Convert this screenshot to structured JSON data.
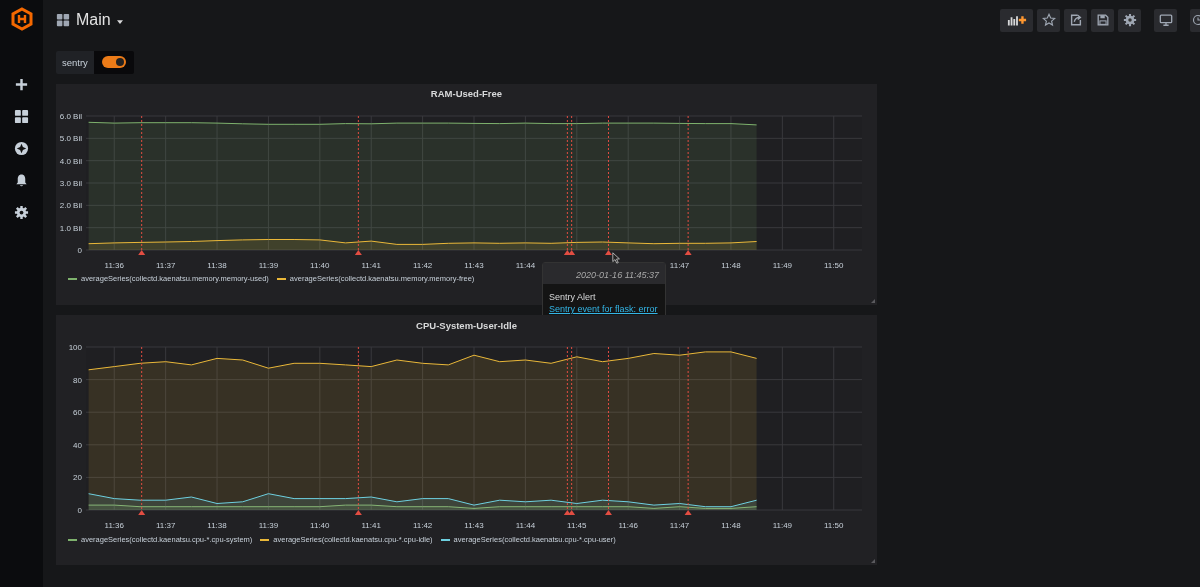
{
  "dashboard": {
    "title": "Main"
  },
  "variables": [
    {
      "label": "sentry",
      "on": true
    }
  ],
  "panels": [
    {
      "title": "RAM-Used-Free",
      "chart_data": {
        "type": "area",
        "categories": [
          null,
          "11:36",
          null,
          "11:37",
          null,
          "11:38",
          null,
          "11:39",
          null,
          "11:40",
          null,
          "11:41",
          null,
          "11:42",
          null,
          "11:43",
          null,
          "11:44",
          null,
          null,
          null,
          null,
          null,
          "11:47",
          null,
          "11:48",
          null,
          "11:49",
          null,
          "11:50",
          null
        ],
        "ylim": [
          0,
          6
        ],
        "yticks": [
          {
            "value": 0,
            "label": "0"
          },
          {
            "value": 1,
            "label": "1.0 Bil"
          },
          {
            "value": 2,
            "label": "2.0 Bil"
          },
          {
            "value": 3,
            "label": "3.0 Bil"
          },
          {
            "value": 4,
            "label": "4.0 Bil"
          },
          {
            "value": 5,
            "label": "5.0 Bil"
          },
          {
            "value": 6,
            "label": "6.0 Bil"
          }
        ],
        "series": [
          {
            "name": "averageSeries(collectd.kaenatsu.memory.memory-used)",
            "color": "#7eb26d",
            "values": [
              5.72,
              5.68,
              5.7,
              5.7,
              5.7,
              5.68,
              5.65,
              5.63,
              5.63,
              5.63,
              5.66,
              5.65,
              5.68,
              5.68,
              5.68,
              5.67,
              5.66,
              5.68,
              5.66,
              5.66,
              5.68,
              5.68,
              5.68,
              5.67,
              5.66,
              5.66,
              5.6,
              null,
              null,
              null,
              null
            ]
          },
          {
            "name": "averageSeries(collectd.kaenatsu.memory.memory-free)",
            "color": "#eab839",
            "values": [
              0.28,
              0.32,
              0.34,
              0.36,
              0.38,
              0.42,
              0.45,
              0.47,
              0.47,
              0.45,
              0.32,
              0.4,
              0.25,
              0.25,
              0.3,
              0.32,
              0.3,
              0.32,
              0.3,
              0.34,
              0.36,
              0.32,
              0.28,
              0.3,
              0.3,
              0.32,
              0.38,
              null,
              null,
              null,
              null
            ]
          }
        ],
        "grid": true,
        "annotations": [
          {
            "x": "11:36:32"
          },
          {
            "x": "11:40:45"
          },
          {
            "x": "11:44:49"
          },
          {
            "x": "11:44:54"
          },
          {
            "x": "11:45:37"
          },
          {
            "x": "11:47:10"
          }
        ]
      },
      "tooltip": {
        "time": "2020-01-16 11:45:37",
        "title": "Sentry Alert",
        "link": "Sentry event for flask: error"
      }
    },
    {
      "title": "CPU-System-User-Idle",
      "chart_data": {
        "type": "area",
        "categories": [
          null,
          "11:36",
          null,
          "11:37",
          null,
          "11:38",
          null,
          "11:39",
          null,
          "11:40",
          null,
          "11:41",
          null,
          "11:42",
          null,
          "11:43",
          null,
          "11:44",
          null,
          "11:45",
          null,
          "11:46",
          null,
          "11:47",
          null,
          "11:48",
          null,
          "11:49",
          null,
          "11:50",
          null
        ],
        "ylim": [
          0,
          100
        ],
        "yticks": [
          0,
          20,
          40,
          60,
          80,
          100
        ],
        "series": [
          {
            "name": "averageSeries(collectd.kaenatsu.cpu-*.cpu-system)",
            "color": "#7eb26d",
            "values": [
              3,
              3,
              2,
              2,
              2,
              2,
              2,
              2,
              2,
              2,
              3,
              3,
              2,
              2,
              2,
              1,
              2,
              2,
              2,
              2,
              2,
              2,
              1,
              2,
              1,
              1,
              2,
              null,
              null,
              null,
              null
            ]
          },
          {
            "name": "averageSeries(collectd.kaenatsu.cpu-*.cpu-idle)",
            "color": "#eab839",
            "values": [
              86,
              88,
              90,
              91,
              89,
              93,
              92,
              87,
              90,
              90,
              89,
              88,
              92,
              90,
              89,
              95,
              91,
              92,
              90,
              94,
              91,
              93,
              96,
              95,
              97,
              97,
              93,
              null,
              null,
              null,
              null
            ]
          },
          {
            "name": "averageSeries(collectd.kaenatsu.cpu-*.cpu-user)",
            "color": "#6ed0e0",
            "values": [
              10,
              7,
              6,
              6,
              8,
              4,
              5,
              10,
              7,
              7,
              7,
              8,
              5,
              7,
              7,
              3,
              6,
              5,
              6,
              4,
              6,
              5,
              3,
              4,
              2,
              2,
              6,
              null,
              null,
              null,
              null
            ]
          }
        ],
        "grid": true,
        "annotations": [
          {
            "x": "11:36:32"
          },
          {
            "x": "11:40:45"
          },
          {
            "x": "11:44:49"
          },
          {
            "x": "11:44:54"
          },
          {
            "x": "11:45:37"
          },
          {
            "x": "11:47:10"
          }
        ]
      }
    }
  ]
}
